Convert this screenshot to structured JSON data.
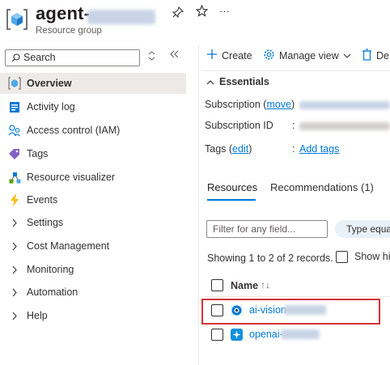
{
  "header": {
    "title": "agent-",
    "subtitle": "Resource group",
    "pin_icon": "pin-icon",
    "star_icon": "star-icon",
    "more_label": "···"
  },
  "sidebar": {
    "search_placeholder": "Search",
    "items": [
      {
        "label": "Overview",
        "icon": "resource-group-icon",
        "active": true
      },
      {
        "label": "Activity log",
        "icon": "activity-log-icon"
      },
      {
        "label": "Access control (IAM)",
        "icon": "people-icon"
      },
      {
        "label": "Tags",
        "icon": "tag-icon"
      },
      {
        "label": "Resource visualizer",
        "icon": "visualizer-icon"
      },
      {
        "label": "Events",
        "icon": "lightning-icon"
      },
      {
        "label": "Settings",
        "icon": "chevron-right-icon"
      },
      {
        "label": "Cost Management",
        "icon": "chevron-right-icon"
      },
      {
        "label": "Monitoring",
        "icon": "chevron-right-icon"
      },
      {
        "label": "Automation",
        "icon": "chevron-right-icon"
      },
      {
        "label": "Help",
        "icon": "chevron-right-icon"
      }
    ]
  },
  "toolbar": {
    "create": "Create",
    "manage_view": "Manage view",
    "delete": "De"
  },
  "essentials": {
    "heading": "Essentials",
    "subscription_label": "Subscription (",
    "subscription_link": "move",
    "subscription_close": ")",
    "subscription_id_label": "Subscription ID",
    "tags_label": "Tags (",
    "tags_link": "edit",
    "tags_close": ")",
    "colon": ":",
    "add_tags": "Add tags"
  },
  "tabs": {
    "resources": "Resources",
    "recommendations": "Recommendations (1)"
  },
  "filter": {
    "placeholder": "Filter for any field...",
    "type_pill": "Type equa"
  },
  "records": {
    "text": "Showing 1 to 2 of 2 records.",
    "show_hidden": "Show hic"
  },
  "table": {
    "name_header": "Name",
    "sort_icon": "↑↓",
    "rows": [
      {
        "name": "ai-vision",
        "icon": "computer-vision-icon"
      },
      {
        "name": "openai-",
        "icon": "openai-icon"
      }
    ]
  },
  "colors": {
    "accent": "#0078d4",
    "highlight": "#d13438",
    "active_bg": "#edebe9"
  }
}
